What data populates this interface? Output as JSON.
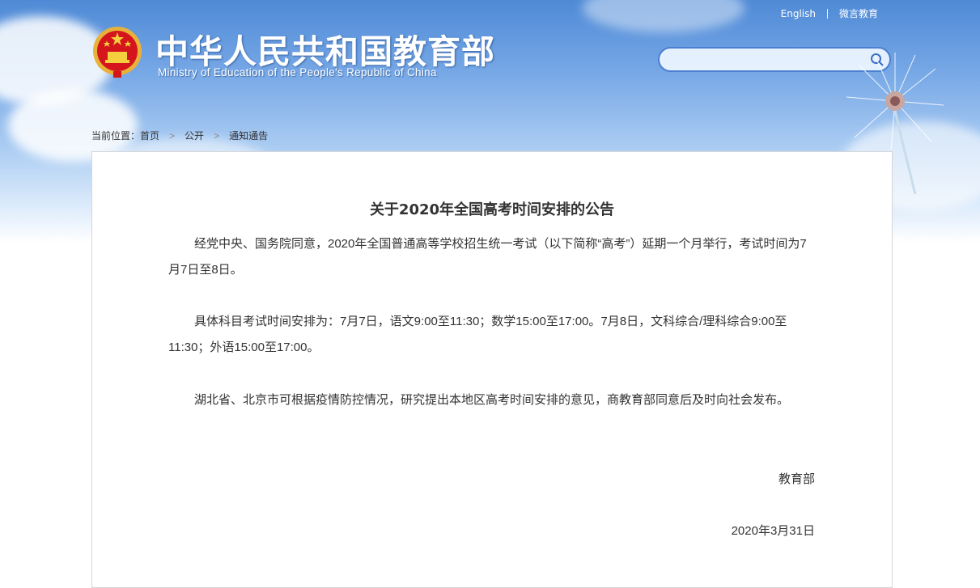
{
  "header": {
    "links": [
      "English",
      "微言教育"
    ],
    "title_cn": "中华人民共和国教育部",
    "title_en": "Ministry of Education of the People's Republic of China",
    "search": {
      "value": "",
      "placeholder": ""
    }
  },
  "breadcrumb": {
    "label": "当前位置：",
    "items": [
      "首页",
      "公开",
      "通知通告"
    ]
  },
  "article": {
    "title": "关于2020年全国高考时间安排的公告",
    "paragraphs": [
      "经党中央、国务院同意，2020年全国普通高等学校招生统一考试（以下简称“高考”）延期一个月举行，考试时间为7月7日至8日。",
      "具体科目考试时间安排为：7月7日，语文9:00至11:30；数学15:00至17:00。7月8日，文科综合/理科综合9:00至11:30；外语15:00至17:00。",
      "湖北省、北京市可根据疫情防控情况，研究提出本地区高考时间安排的意见，商教育部同意后及时向社会发布。"
    ],
    "signature": "教育部",
    "date": "2020年3月31日"
  },
  "colors": {
    "sky_top": "#4f8ad6",
    "search_border": "#4a7fd1",
    "text": "#333333"
  },
  "icons": [
    "national-emblem",
    "search-icon",
    "chevron-right-icon",
    "dandelion-decoration"
  ]
}
